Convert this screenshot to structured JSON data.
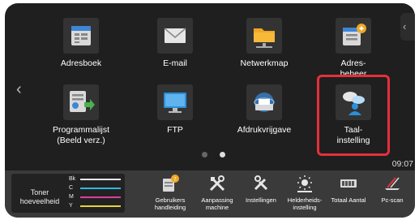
{
  "apps": [
    {
      "label": "Adresboek",
      "icon": "address-book-icon"
    },
    {
      "label": "E-mail",
      "icon": "email-icon"
    },
    {
      "label": "Netwerkmap",
      "icon": "network-folder-icon"
    },
    {
      "label": "Adres-\nbeheer",
      "icon": "address-management-icon"
    },
    {
      "label": "Programmalijst\n(Beeld verz.)",
      "icon": "program-list-icon"
    },
    {
      "label": "FTP",
      "icon": "ftp-monitor-icon"
    },
    {
      "label": "Afdrukvrijgave",
      "icon": "print-release-icon"
    },
    {
      "label": "Taal-\ninstelling",
      "icon": "language-setting-icon"
    }
  ],
  "clock": "09:07",
  "pagination": {
    "pages": 2,
    "current": 2
  },
  "toner": {
    "title": "Toner\nhoeveelheid",
    "channels": [
      {
        "label": "Bk",
        "color": "#e6e6e6"
      },
      {
        "label": "C",
        "color": "#2fb8e0"
      },
      {
        "label": "M",
        "color": "#d8409a"
      },
      {
        "label": "Y",
        "color": "#e8d23a"
      }
    ]
  },
  "bottom_items": [
    {
      "label": "Gebruikers\nhandleiding",
      "icon": "user-manual-icon"
    },
    {
      "label": "Aanpassing\nmachine",
      "icon": "machine-adjust-icon"
    },
    {
      "label": "Instellingen",
      "icon": "settings-tools-icon"
    },
    {
      "label": "Helderheids-\ninstelling",
      "icon": "brightness-icon"
    },
    {
      "label": "Totaal Aantal",
      "icon": "total-count-icon"
    },
    {
      "label": "Pc-scan",
      "icon": "pc-scan-icon"
    }
  ],
  "colors": {
    "highlight": "#e5303b",
    "background": "#1f1f1f",
    "bar": "#3a3a3a"
  }
}
